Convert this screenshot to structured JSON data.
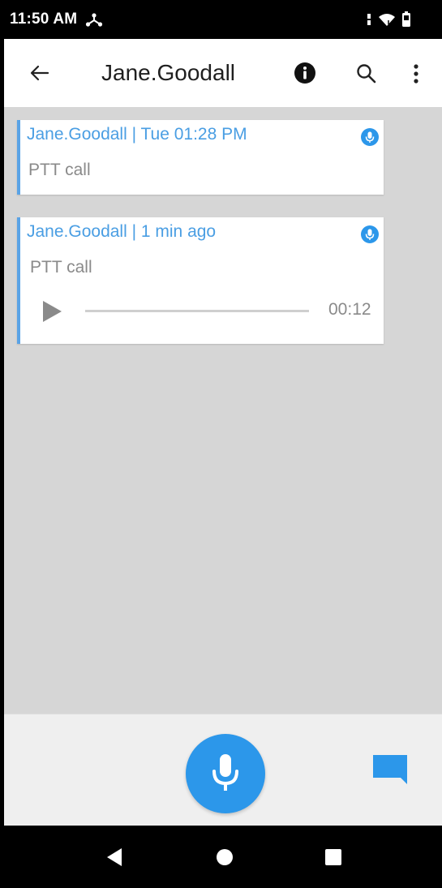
{
  "status_bar": {
    "time": "11:50 AM",
    "left_icons": [
      "network-share-icon"
    ],
    "right_icons": [
      "vibrate-icon",
      "wifi-icon",
      "battery-icon"
    ]
  },
  "toolbar": {
    "title": "Jane.Goodall",
    "icons": [
      "back-arrow-icon",
      "info-icon",
      "search-icon",
      "more-vert-icon"
    ]
  },
  "messages": [
    {
      "header": "Jane.Goodall | Tue 01:28 PM",
      "body": "PTT call",
      "icon": "mic-icon"
    },
    {
      "header": "Jane.Goodall | 1 min ago",
      "body": "PTT call",
      "icon": "mic-icon",
      "audio": {
        "duration": "00:12",
        "progress": 0
      }
    }
  ],
  "bottom_bar": {
    "icons": [
      "microphone-icon",
      "chat-bubble-icon"
    ]
  },
  "nav_bar": {
    "icons": [
      "nav-back-icon",
      "nav-home-icon",
      "nav-recents-icon"
    ]
  },
  "colors": {
    "accent": "#2c97ea",
    "header_text": "#4a9ee3",
    "body_text": "#8a8a8a",
    "background": "#d6d6d6"
  }
}
